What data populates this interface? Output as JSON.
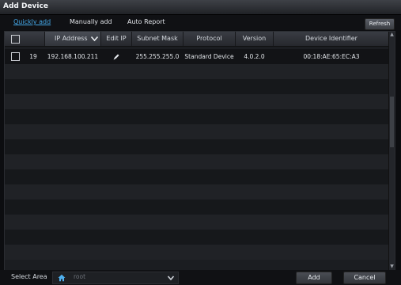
{
  "window": {
    "title": "Add Device"
  },
  "tabs": [
    {
      "label": "Quickly add",
      "active": true
    },
    {
      "label": "Manually add",
      "active": false
    },
    {
      "label": "Auto Report",
      "active": false
    }
  ],
  "toolbar": {
    "refresh_label": "Refresh"
  },
  "table": {
    "columns": [
      "IP Address",
      "Edit IP a...",
      "Subnet Mask",
      "Protocol",
      "Version",
      "Device Identifier"
    ],
    "rows": [
      {
        "index": "19",
        "ip": "192.168.100.211",
        "edit_icon": "pencil-icon",
        "subnet": "255.255.255.0",
        "protocol": "Standard Device",
        "version": "4.0.2.0",
        "device_id": "00:18:AE:65:EC:A3"
      }
    ]
  },
  "footer": {
    "select_area_label": "Select Area",
    "area_value": "root",
    "add_label": "Add",
    "cancel_label": "Cancel"
  },
  "colors": {
    "accent": "#45a8e8",
    "background": "#0c0d10",
    "table_bg": "#1b1d21"
  }
}
